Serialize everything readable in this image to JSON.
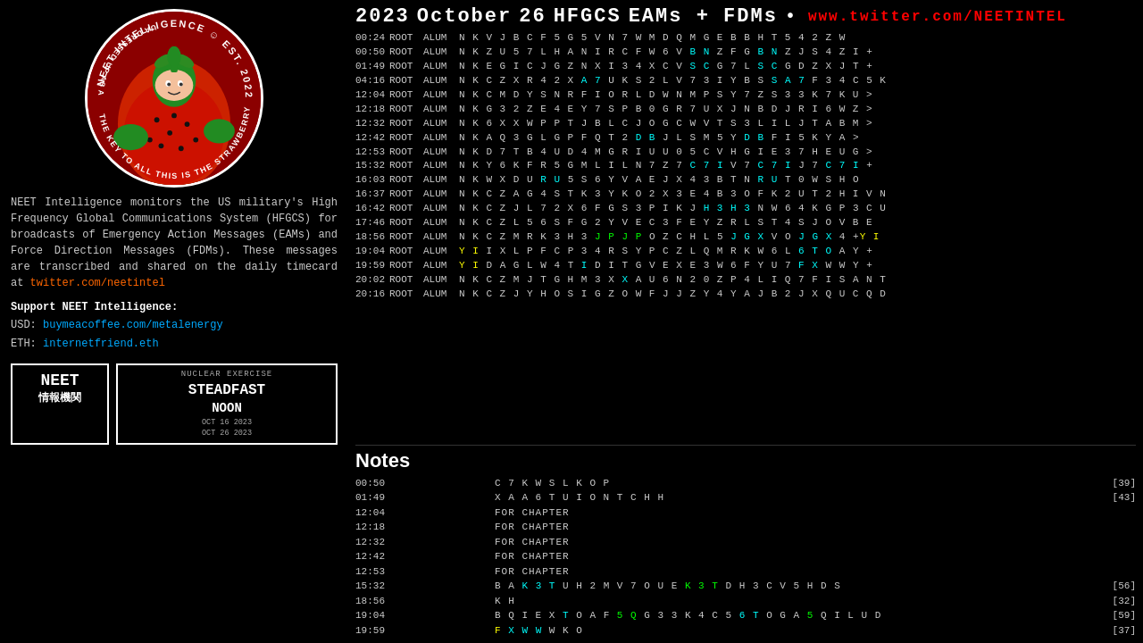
{
  "header": {
    "year": "2023",
    "month": "October",
    "day": "26",
    "system": "HFGCS",
    "type": "EAMs + FDMs",
    "dot": "•",
    "twitter": "www.twitter.com/NEETINTEL"
  },
  "description": {
    "text": "NEET Intelligence monitors the US military's High Frequency Global Communications System (HFGCS) for broadcasts of Emergency Action Messages (EAMs) and Force Direction Messages (FDMs). These messages are transcribed and shared on the daily timecard at",
    "link_text": "twitter.com/neetintel",
    "link_url": "twitter.com/neetintel"
  },
  "support": {
    "label": "Support NEET Intelligence:",
    "usd_label": "USD:",
    "usd_link": "buymeacoffee.com/metalenergy",
    "eth_label": "ETH:",
    "eth_link": "internetfriend.eth"
  },
  "badge_neet": {
    "line1": "NEET",
    "line2": "情報機関"
  },
  "badge_exercise": {
    "nuclear": "NUCLEAR EXERCISE",
    "name": "STEADFAST",
    "noon": "NOON",
    "date1": "OCT 16 2023",
    "date2": "OCT 26 2023"
  },
  "notes_title": "Notes",
  "messages": [
    {
      "time": "00:24",
      "root": "ROOT",
      "alum": "ALUM",
      "body": "N K V J B C F 5 G 5 V N 7 W M D Q M G E B B H T 5 4 2 Z W"
    },
    {
      "time": "00:50",
      "root": "ROOT",
      "alum": "ALUM",
      "body_parts": [
        {
          "text": "N K Z U 5 7 L H A N I R C F W 6 V "
        },
        {
          "text": "B",
          "class": "c-cyan"
        },
        {
          "text": " "
        },
        {
          "text": "N",
          "class": "c-cyan"
        },
        {
          "text": " Z F G "
        },
        {
          "text": "B",
          "class": "c-cyan"
        },
        {
          "text": " "
        },
        {
          "text": "N",
          "class": "c-cyan"
        },
        {
          "text": " Z J S 4 Z I +"
        }
      ]
    },
    {
      "time": "01:49",
      "root": "ROOT",
      "alum": "ALUM",
      "body_parts": [
        {
          "text": "N K E G I C J G Z N X I 3 4 X C V "
        },
        {
          "text": "S",
          "class": "c-cyan"
        },
        {
          "text": " "
        },
        {
          "text": "C",
          "class": "c-cyan"
        },
        {
          "text": " G 7 L "
        },
        {
          "text": "S",
          "class": "c-cyan"
        },
        {
          "text": " "
        },
        {
          "text": "C",
          "class": "c-cyan"
        },
        {
          "text": " G D Z X J T +"
        }
      ]
    },
    {
      "time": "04:16",
      "root": "ROOT",
      "alum": "ALUM",
      "body_parts": [
        {
          "text": "N K C Z X R 4 2 X "
        },
        {
          "text": "A",
          "class": "c-cyan"
        },
        {
          "text": " "
        },
        {
          "text": "7",
          "class": "c-cyan"
        },
        {
          "text": " U K S 2 L V 7 3 I Y B S "
        },
        {
          "text": "S",
          "class": "c-cyan"
        },
        {
          "text": " "
        },
        {
          "text": "A",
          "class": "c-cyan"
        },
        {
          "text": " "
        },
        {
          "text": "7",
          "class": "c-cyan"
        },
        {
          "text": " F 3 4 C 5 K"
        }
      ]
    },
    {
      "time": "12:04",
      "root": "ROOT",
      "alum": "ALUM",
      "body": "N K C M D Y S N R F I O R L D W N M P S Y 7 Z S 3 3 K 7 K U >"
    },
    {
      "time": "12:18",
      "root": "ROOT",
      "alum": "ALUM",
      "body": "N K G 3 2 Z E 4 E Y 7 S P B 0 G R 7 U X J N B D J R I 6 W Z >"
    },
    {
      "time": "12:32",
      "root": "ROOT",
      "alum": "ALUM",
      "body_parts": [
        {
          "text": "N K 6 X X W P P T J B L C J O G C W V T S 3 L I L J T A B M "
        },
        {
          "text": ">"
        }
      ]
    },
    {
      "time": "12:42",
      "root": "ROOT",
      "alum": "ALUM",
      "body_parts": [
        {
          "text": "N K A Q 3 G L G P F Q T 2 "
        },
        {
          "text": "D",
          "class": "c-cyan"
        },
        {
          "text": " "
        },
        {
          "text": "B",
          "class": "c-cyan"
        },
        {
          "text": " J L S M 5 Y "
        },
        {
          "text": "D",
          "class": "c-cyan"
        },
        {
          "text": " "
        },
        {
          "text": "B",
          "class": "c-cyan"
        },
        {
          "text": " F I 5 K Y A >"
        }
      ]
    },
    {
      "time": "12:53",
      "root": "ROOT",
      "alum": "ALUM",
      "body": "N K D 7 T B 4 U D 4 M G R I U U 0 5 C V H G I E 3 7 H E U G >"
    },
    {
      "time": "15:32",
      "root": "ROOT",
      "alum": "ALUM",
      "body_parts": [
        {
          "text": "N K Y 6 K F R 5 G M L I L N 7 Z 7 "
        },
        {
          "text": "C",
          "class": "c-cyan"
        },
        {
          "text": " "
        },
        {
          "text": "7",
          "class": "c-cyan"
        },
        {
          "text": " "
        },
        {
          "text": "I",
          "class": "c-cyan"
        },
        {
          "text": " V 7 "
        },
        {
          "text": "C",
          "class": "c-cyan"
        },
        {
          "text": " "
        },
        {
          "text": "7",
          "class": "c-cyan"
        },
        {
          "text": " "
        },
        {
          "text": "I",
          "class": "c-cyan"
        },
        {
          "text": " J 7 "
        },
        {
          "text": "C",
          "class": "c-cyan"
        },
        {
          "text": " "
        },
        {
          "text": "7",
          "class": "c-cyan"
        },
        {
          "text": " "
        },
        {
          "text": "I",
          "class": "c-cyan"
        },
        {
          "text": " +"
        }
      ]
    },
    {
      "time": "16:03",
      "root": "ROOT",
      "alum": "ALUM",
      "body_parts": [
        {
          "text": "N K W X D U "
        },
        {
          "text": "R",
          "class": "c-cyan"
        },
        {
          "text": " "
        },
        {
          "text": "U",
          "class": "c-cyan"
        },
        {
          "text": " 5 S 6 Y V A E J X 4 3 B T N "
        },
        {
          "text": "R",
          "class": "c-cyan"
        },
        {
          "text": " "
        },
        {
          "text": "U",
          "class": "c-cyan"
        },
        {
          "text": " T 0 W S H O"
        }
      ]
    },
    {
      "time": "16:37",
      "root": "ROOT",
      "alum": "ALUM",
      "body": "N K C Z A G 4 S T K 3 Y K O 2 X 3 E 4 B 3 O F K 2 U T 2 H I V N"
    },
    {
      "time": "16:42",
      "root": "ROOT",
      "alum": "ALUM",
      "body_parts": [
        {
          "text": "N K C Z J L 7 2 X 6 F G S 3 P I K J "
        },
        {
          "text": "H",
          "class": "c-cyan"
        },
        {
          "text": " "
        },
        {
          "text": "3",
          "class": "c-cyan"
        },
        {
          "text": " "
        },
        {
          "text": "H",
          "class": "c-cyan"
        },
        {
          "text": " "
        },
        {
          "text": "3",
          "class": "c-cyan"
        },
        {
          "text": " N W 6 4 K G P 3 C U"
        }
      ]
    },
    {
      "time": "17:46",
      "root": "ROOT",
      "alum": "ALUM",
      "body": "N K C Z L 5 6 S F G 2 Y V E C 3 F E Y Z R L S T 4 S J O V B E"
    },
    {
      "time": "18:56",
      "root": "ROOT",
      "alum": "ALUM",
      "body_parts": [
        {
          "text": "N K C Z M R K 3 H 3 "
        },
        {
          "text": "J",
          "class": "c-green"
        },
        {
          "text": " "
        },
        {
          "text": "P",
          "class": "c-green"
        },
        {
          "text": " "
        },
        {
          "text": "J",
          "class": "c-green"
        },
        {
          "text": " "
        },
        {
          "text": "P",
          "class": "c-green"
        },
        {
          "text": " O Z C H L 5 "
        },
        {
          "text": "J",
          "class": "c-cyan"
        },
        {
          "text": " "
        },
        {
          "text": "G",
          "class": "c-cyan"
        },
        {
          "text": " "
        },
        {
          "text": "X",
          "class": "c-cyan"
        },
        {
          "text": " V O "
        },
        {
          "text": "J",
          "class": "c-cyan"
        },
        {
          "text": " "
        },
        {
          "text": "G",
          "class": "c-cyan"
        },
        {
          "text": " "
        },
        {
          "text": "X",
          "class": "c-cyan"
        },
        {
          "text": " 4 +"
        },
        {
          "text": "Y",
          "class": "c-yellow"
        },
        {
          "text": " "
        },
        {
          "text": "I",
          "class": "c-yellow"
        }
      ]
    },
    {
      "time": "19:04",
      "root": "ROOT",
      "alum": "ALUM",
      "body_parts": [
        {
          "text": "Y",
          "class": "c-yellow"
        },
        {
          "text": " "
        },
        {
          "text": "I",
          "class": "c-yellow"
        },
        {
          "text": " I X L P F C P 3 4 R S Y P C Z L Q M R K W 6 L "
        },
        {
          "text": "6",
          "class": "c-cyan"
        },
        {
          "text": " "
        },
        {
          "text": "T",
          "class": "c-cyan"
        },
        {
          "text": " "
        },
        {
          "text": "O",
          "class": "c-cyan"
        },
        {
          "text": " A Y +"
        }
      ]
    },
    {
      "time": "19:59",
      "root": "ROOT",
      "alum": "ALUM",
      "body_parts": [
        {
          "text": "Y",
          "class": "c-yellow"
        },
        {
          "text": " "
        },
        {
          "text": "I",
          "class": "c-yellow"
        },
        {
          "text": " D A G L W 4 T "
        },
        {
          "text": "I",
          "class": "c-cyan"
        },
        {
          "text": " D I T G V E X E 3 W 6 F Y U 7 "
        },
        {
          "text": "F",
          "class": "c-cyan"
        },
        {
          "text": " "
        },
        {
          "text": "X",
          "class": "c-cyan"
        },
        {
          "text": " W W Y +"
        }
      ]
    },
    {
      "time": "20:02",
      "root": "ROOT",
      "alum": "ALUM",
      "body_parts": [
        {
          "text": "N K C Z M J T G H M 3 X "
        },
        {
          "text": "X",
          "class": "c-cyan"
        },
        {
          "text": " A U 6 N 2 0 Z P 4 L I Q 7 F I S A N T"
        }
      ]
    },
    {
      "time": "20:16",
      "root": "ROOT",
      "alum": "ALUM",
      "body": "N K C Z J Y H O S I G Z O W F J J Z Y 4 Y A J B 2 J X Q U C Q D"
    }
  ],
  "notes": [
    {
      "time": "00:50",
      "spacer": true,
      "body_parts": [
        {
          "text": "C 7 K W S L K O P"
        }
      ],
      "count": "[39]"
    },
    {
      "time": "01:49",
      "spacer": true,
      "body_parts": [
        {
          "text": "X A A 6 T U I O N T C H H"
        }
      ],
      "count": "[43]"
    },
    {
      "time": "12:04",
      "spacer": true,
      "body_parts": [
        {
          "text": "FOR CHAPTER"
        }
      ],
      "count": ""
    },
    {
      "time": "12:18",
      "spacer": true,
      "body_parts": [
        {
          "text": "FOR CHAPTER"
        }
      ],
      "count": ""
    },
    {
      "time": "12:32",
      "spacer": true,
      "body_parts": [
        {
          "text": "FOR CHAPTER"
        }
      ],
      "count": ""
    },
    {
      "time": "12:42",
      "spacer": true,
      "body_parts": [
        {
          "text": "FOR CHAPTER"
        }
      ],
      "count": ""
    },
    {
      "time": "12:53",
      "spacer": true,
      "body_parts": [
        {
          "text": "FOR CHAPTER"
        }
      ],
      "count": ""
    },
    {
      "time": "15:32",
      "spacer": true,
      "body_parts": [
        {
          "text": "B A "
        },
        {
          "text": "K",
          "class": "c-cyan"
        },
        {
          "text": " "
        },
        {
          "text": "3",
          "class": "c-cyan"
        },
        {
          "text": " "
        },
        {
          "text": "T",
          "class": "c-cyan"
        },
        {
          "text": " U H 2 M V 7 O U E "
        },
        {
          "text": "K",
          "class": "c-green"
        },
        {
          "text": " "
        },
        {
          "text": "3",
          "class": "c-green"
        },
        {
          "text": " "
        },
        {
          "text": "T",
          "class": "c-green"
        },
        {
          "text": " D H 3 C V 5 H D S"
        }
      ],
      "count": "[56]"
    },
    {
      "time": "18:56",
      "spacer": true,
      "body_parts": [
        {
          "text": "K H"
        }
      ],
      "count": "[32]"
    },
    {
      "time": "19:04",
      "spacer": true,
      "body_parts": [
        {
          "text": "B Q I E X "
        },
        {
          "text": "T",
          "class": "c-cyan"
        },
        {
          "text": " O A F "
        },
        {
          "text": "5",
          "class": "c-green"
        },
        {
          "text": " "
        },
        {
          "text": "Q",
          "class": "c-green"
        },
        {
          "text": " G 3 3 K 4 C 5 "
        },
        {
          "text": "6",
          "class": "c-cyan"
        },
        {
          "text": " "
        },
        {
          "text": "T",
          "class": "c-cyan"
        },
        {
          "text": " O G A "
        },
        {
          "text": "5",
          "class": "c-green"
        },
        {
          "text": " Q I L U D"
        }
      ],
      "count": "[59]"
    },
    {
      "time": "19:59",
      "spacer": true,
      "body_parts": [
        {
          "text": "F",
          "class": "c-yellow"
        },
        {
          "text": " "
        },
        {
          "text": "X",
          "class": "c-cyan"
        },
        {
          "text": " "
        },
        {
          "text": "W",
          "class": "c-cyan"
        },
        {
          "text": " "
        },
        {
          "text": "W",
          "class": "c-cyan"
        },
        {
          "text": " W K O"
        }
      ],
      "count": "[37]"
    }
  ]
}
